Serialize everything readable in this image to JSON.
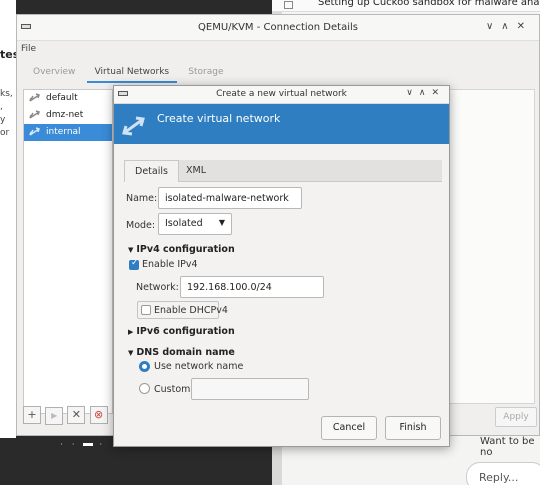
{
  "background": {
    "browser_tab_title": "Setting up Cuckoo sandbox for malware analysis",
    "chat_text": "Want to be no",
    "reply_placeholder": "Reply...",
    "left_cut_heading": "tes",
    "left_cut_line1": "ks, ,",
    "left_cut_line2": "y or"
  },
  "connection_window": {
    "title": "QEMU/KVM - Connection Details",
    "menu_file": "File",
    "tabs": [
      {
        "label": "Overview"
      },
      {
        "label": "Virtual Networks"
      },
      {
        "label": "Storage"
      }
    ],
    "networks": [
      {
        "label": "default"
      },
      {
        "label": "dmz-net"
      },
      {
        "label": "internal"
      }
    ],
    "btn_add": "+",
    "btn_start": "▶",
    "btn_stop": "✕",
    "apply_label": "Apply"
  },
  "dialog": {
    "title": "Create a new virtual network",
    "banner_title": "Create virtual network",
    "tabs": [
      {
        "label": "Details"
      },
      {
        "label": "XML"
      }
    ],
    "name_label": "Name:",
    "name_value": "isolated-malware-network",
    "mode_label": "Mode:",
    "mode_value": "Isolated",
    "ipv4_section": "IPv4 configuration",
    "enable_ipv4_label": "Enable IPv4",
    "enable_ipv4_checked": true,
    "network_label": "Network:",
    "network_value": "192.168.100.0/24",
    "enable_dhcp_label": "Enable DHCPv4",
    "enable_dhcp_checked": false,
    "ipv6_section": "IPv6 configuration",
    "dns_section": "DNS domain name",
    "dns_options": [
      {
        "label": "Use network name",
        "selected": true
      },
      {
        "label": "Custom",
        "selected": false
      }
    ],
    "custom_value": "",
    "cancel_label": "Cancel",
    "finish_label": "Finish"
  },
  "colors": {
    "accent": "#2e7ec1",
    "selection": "#3a8bd8"
  },
  "icons": {
    "window_app": "virt-manager-icon",
    "network": "network-arrows-icon"
  }
}
